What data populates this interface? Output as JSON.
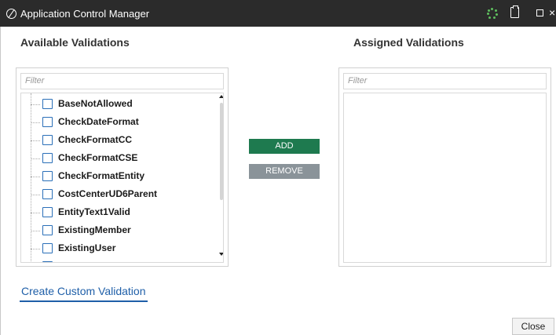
{
  "window": {
    "title": "Application Control Manager"
  },
  "available": {
    "heading": "Available Validations",
    "filter_placeholder": "Filter",
    "items": [
      {
        "label": "BaseNotAllowed",
        "checked": false
      },
      {
        "label": "CheckDateFormat",
        "checked": false
      },
      {
        "label": "CheckFormatCC",
        "checked": false
      },
      {
        "label": "CheckFormatCSE",
        "checked": false
      },
      {
        "label": "CheckFormatEntity",
        "checked": false
      },
      {
        "label": "CostCenterUD6Parent",
        "checked": false
      },
      {
        "label": "EntityText1Valid",
        "checked": false
      },
      {
        "label": "ExistingMember",
        "checked": false
      },
      {
        "label": "ExistingUser",
        "checked": false
      }
    ]
  },
  "assigned": {
    "heading": "Assigned Validations",
    "filter_placeholder": "Filter",
    "items": []
  },
  "actions": {
    "add_label": "ADD",
    "remove_label": "REMOVE"
  },
  "footer": {
    "create_link": "Create Custom Validation",
    "close_label": "Close"
  },
  "colors": {
    "titlebar": "#2b2b2b",
    "add_button": "#1e7a4f",
    "remove_button": "#8a9399",
    "link": "#1f5fa8",
    "checkbox_border": "#2a6fb8"
  }
}
